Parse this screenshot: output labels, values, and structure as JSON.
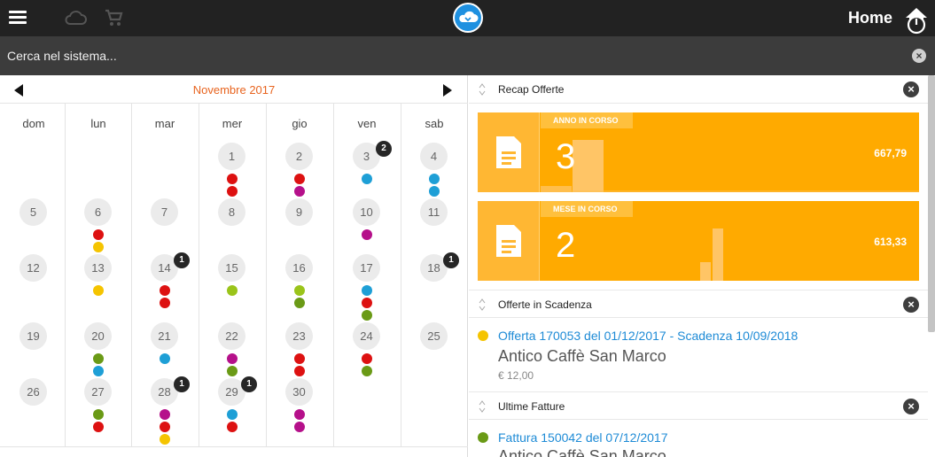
{
  "topbar": {
    "title": "Home",
    "colors": {
      "bar": "#222222",
      "logo_bg": "#1e90e0"
    }
  },
  "search": {
    "placeholder": "Cerca nel sistema..."
  },
  "calendar": {
    "month_label": "Novembre 2017",
    "weekdays": [
      "dom",
      "lun",
      "mar",
      "mer",
      "gio",
      "ven",
      "sab"
    ],
    "days": [
      {
        "n": "1",
        "dots": [
          "#dd1111",
          "#dd1111"
        ]
      },
      {
        "n": "2",
        "dots": [
          "#dd1111",
          "#b5108a"
        ]
      },
      {
        "n": "3",
        "badge": "2",
        "dots": [
          "#1e9fd6"
        ]
      },
      {
        "n": "4",
        "dots": [
          "#1e9fd6",
          "#1e9fd6"
        ]
      },
      {
        "n": "5",
        "dots": []
      },
      {
        "n": "6",
        "dots": [
          "#dd1111",
          "#f5c400"
        ]
      },
      {
        "n": "7",
        "dots": []
      },
      {
        "n": "8",
        "dots": []
      },
      {
        "n": "9",
        "dots": []
      },
      {
        "n": "10",
        "dots": [
          "#b5108a"
        ]
      },
      {
        "n": "11",
        "dots": []
      },
      {
        "n": "12",
        "dots": []
      },
      {
        "n": "13",
        "dots": [
          "#f5c400"
        ]
      },
      {
        "n": "14",
        "badge": "1",
        "dots": [
          "#dd1111",
          "#dd1111"
        ]
      },
      {
        "n": "15",
        "dots": [
          "#9ac41a"
        ]
      },
      {
        "n": "16",
        "dots": [
          "#9ac41a",
          "#6a9a16"
        ]
      },
      {
        "n": "17",
        "dots": [
          "#1e9fd6",
          "#dd1111",
          "#6a9a16"
        ]
      },
      {
        "n": "18",
        "badge": "1",
        "dots": []
      },
      {
        "n": "19",
        "dots": []
      },
      {
        "n": "20",
        "dots": [
          "#6a9a16",
          "#1e9fd6"
        ]
      },
      {
        "n": "21",
        "dots": [
          "#1e9fd6"
        ]
      },
      {
        "n": "22",
        "dots": [
          "#b5108a",
          "#6a9a16"
        ]
      },
      {
        "n": "23",
        "dots": [
          "#dd1111",
          "#dd1111"
        ]
      },
      {
        "n": "24",
        "dots": [
          "#dd1111",
          "#6a9a16"
        ]
      },
      {
        "n": "25",
        "dots": []
      },
      {
        "n": "26",
        "dots": []
      },
      {
        "n": "27",
        "dots": [
          "#6a9a16",
          "#dd1111"
        ]
      },
      {
        "n": "28",
        "badge": "1",
        "dots": [
          "#b5108a",
          "#dd1111",
          "#f5c400"
        ]
      },
      {
        "n": "29",
        "badge": "1",
        "dots": [
          "#1e9fd6",
          "#dd1111"
        ]
      },
      {
        "n": "30",
        "dots": [
          "#b5108a",
          "#b5108a"
        ]
      }
    ]
  },
  "widgets": {
    "recap": {
      "title": "Recap Offerte",
      "year": {
        "tag": "ANNO IN CORSO",
        "count": "3",
        "amount": "667,79"
      },
      "month": {
        "tag": "MESE IN CORSO",
        "count": "2",
        "amount": "613,33"
      }
    },
    "scadenza": {
      "title": "Offerte in Scadenza",
      "items": [
        {
          "link": "Offerta 170053 del 01/12/2017 - Scadenza 10/09/2018",
          "company": "Antico Caffè San Marco",
          "amount": "€ 12,00",
          "dot_color": "#f5c400"
        }
      ]
    },
    "fatture": {
      "title": "Ultime Fatture",
      "items": [
        {
          "link": "Fattura 150042 del 07/12/2017",
          "company": "Antico Caffè San Marco",
          "dot_color": "#6a9a16"
        }
      ]
    }
  },
  "colors": {
    "accent_orange": "#ffaa00",
    "month_label": "#e8641f",
    "link_blue": "#1e8bd6"
  }
}
